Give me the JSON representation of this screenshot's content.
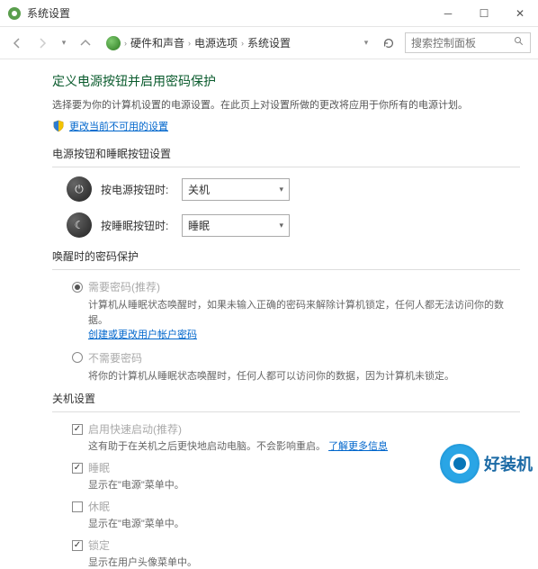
{
  "titlebar": {
    "title": "系统设置"
  },
  "breadcrumb": {
    "item1": "硬件和声音",
    "item2": "电源选项",
    "item3": "系统设置"
  },
  "search": {
    "placeholder": "搜索控制面板"
  },
  "page": {
    "heading": "定义电源按钮并启用密码保护",
    "subtext": "选择要为你的计算机设置的电源设置。在此页上对设置所做的更改将应用于你所有的电源计划。",
    "change_link": "更改当前不可用的设置"
  },
  "power_section": {
    "title": "电源按钮和睡眠按钮设置",
    "row1": {
      "label": "按电源按钮时:",
      "value": "关机"
    },
    "row2": {
      "label": "按睡眠按钮时:",
      "value": "睡眠"
    }
  },
  "wake_section": {
    "title": "唤醒时的密码保护",
    "opt1": {
      "label": "需要密码(推荐)",
      "desc": "计算机从睡眠状态唤醒时，如果未输入正确的密码来解除计算机锁定，任何人都无法访问你的数据。",
      "link": "创建或更改用户帐户密码"
    },
    "opt2": {
      "label": "不需要密码",
      "desc": "将你的计算机从睡眠状态唤醒时，任何人都可以访问你的数据，因为计算机未锁定。"
    }
  },
  "shutdown_section": {
    "title": "关机设置",
    "fastboot": {
      "label": "启用快速启动(推荐)",
      "desc": "这有助于在关机之后更快地启动电脑。不会影响重启。",
      "link": "了解更多信息"
    },
    "sleep": {
      "label": "睡眠",
      "desc": "显示在\"电源\"菜单中。"
    },
    "hibernate": {
      "label": "休眠",
      "desc": "显示在\"电源\"菜单中。"
    },
    "lock": {
      "label": "锁定",
      "desc": "显示在用户头像菜单中。"
    }
  },
  "watermark": {
    "text": "好装机"
  }
}
